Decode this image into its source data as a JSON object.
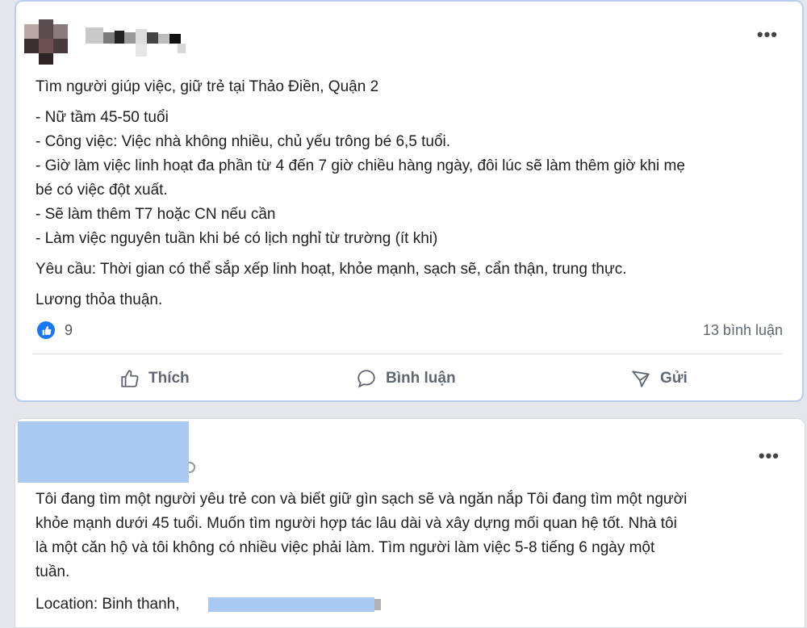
{
  "post1": {
    "body_lines": [
      "Tìm người giúp việc, giữ trẻ tại Thảo Điền, Quận 2",
      "- Nữ tầm 45-50 tuổi",
      "- Công việc: Việc nhà không nhiều, chủ yếu trông bé 6,5 tuổi.",
      "- Giờ làm việc linh hoạt đa phần từ 4 đến 7 giờ chiều hàng ngày, đôi lúc sẽ làm thêm giờ khi mẹ",
      "bé có việc đột xuất.",
      "- Sẽ làm thêm T7 hoặc CN nếu cần",
      "- Làm việc nguyên tuần khi bé có lịch nghỉ từ trường (ít khi)",
      "Yêu cầu: Thời gian có thể sắp xếp linh hoạt, khỏe mạnh, sạch sẽ, cẩn thận, trung thực.",
      "Lương thỏa thuận."
    ],
    "reaction_count": "9",
    "comment_count": "13 bình luận",
    "actions": {
      "like": "Thích",
      "comment": "Bình luận",
      "share": "Gửi"
    },
    "more": "•••"
  },
  "post2": {
    "body_lines": [
      "Tôi đang tìm một người yêu trẻ con và biết giữ gìn sạch sẽ và ngăn nắp Tôi đang tìm một người",
      "khỏe mạnh dưới 45 tuổi.  Muốn tìm người hợp tác lâu dài và xây dựng mối quan hệ tốt.  Nhà tôi",
      "là một căn hộ và tôi không có nhiều việc phải làm.  Tìm người làm việc 5-8 tiếng 6 ngày một",
      "tuần."
    ],
    "location": "Location: Binh thanh,",
    "more": "•••"
  },
  "colors": {
    "accent": "#1877f2",
    "highlight_border": "#b9cdf0",
    "redaction_blue": "#a9c9f2"
  }
}
